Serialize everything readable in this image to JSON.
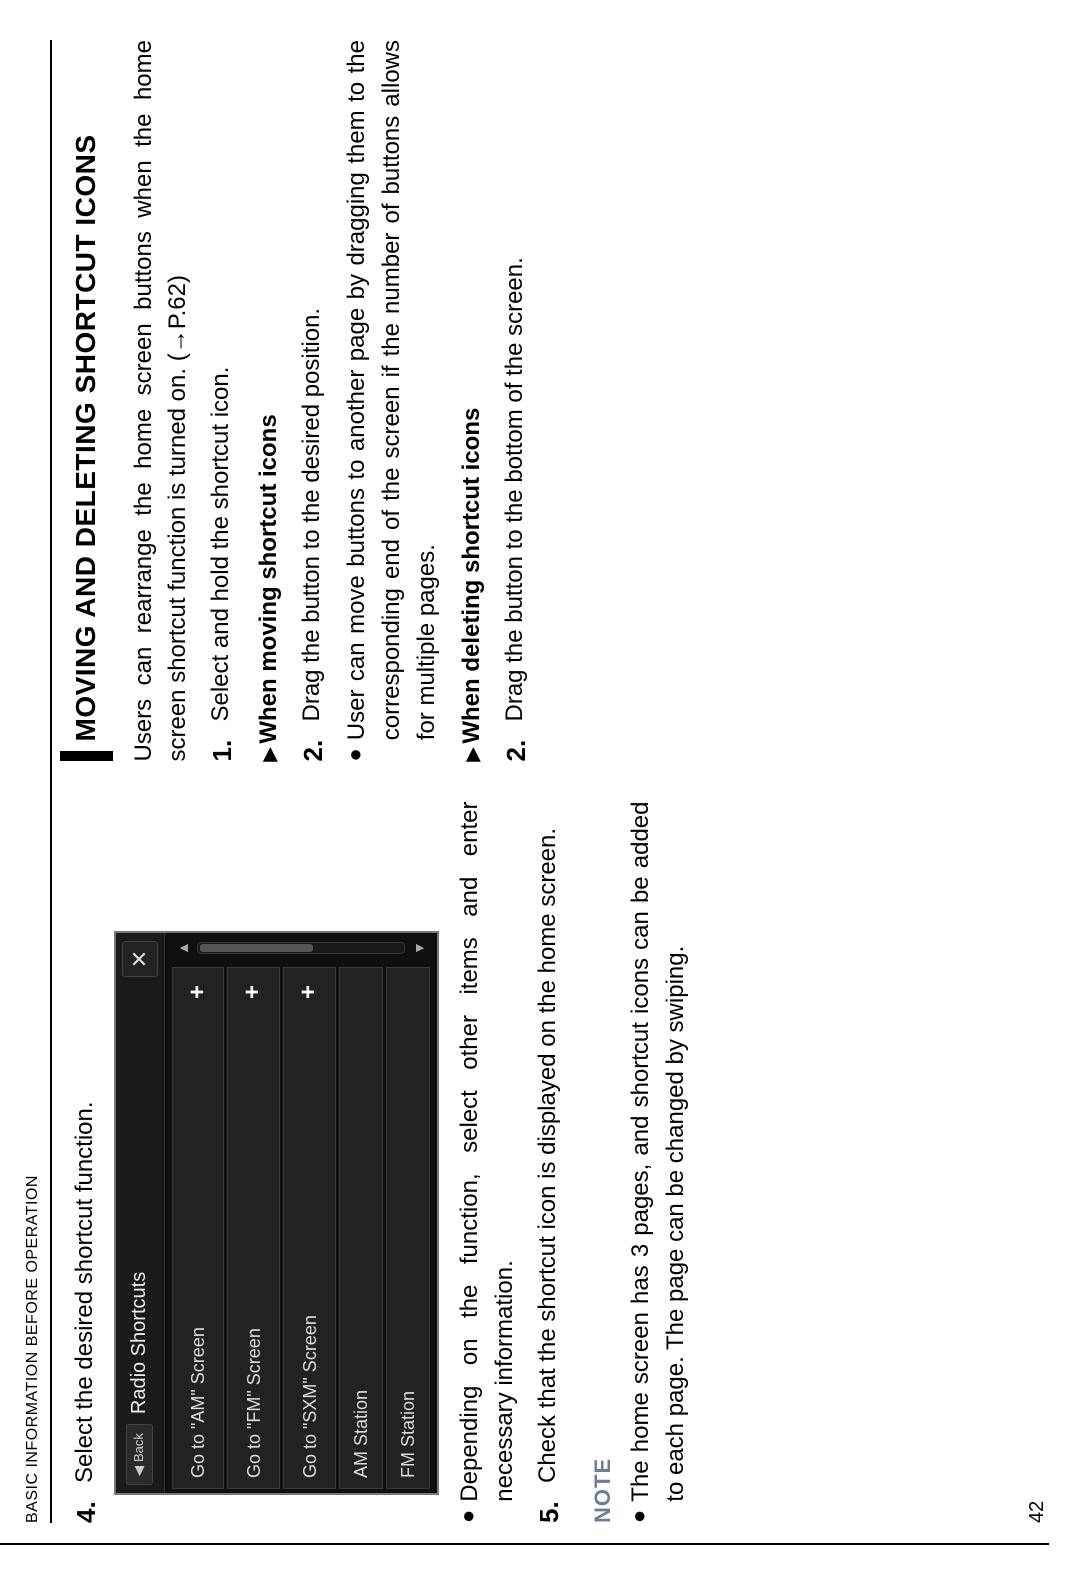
{
  "running_header": "BASIC INFORMATION BEFORE OPERATION",
  "page_number": "42",
  "left": {
    "step4_num": "4.",
    "step4_text": "Select the desired shortcut function.",
    "bullet1": "Depending on the function, select other items and enter necessary information.",
    "step5_num": "5.",
    "step5_text": "Check that the shortcut icon is displayed on the home screen.",
    "note_label": "NOTE",
    "note_bullet": "The home screen has 3 pages, and shortcut icons can be added to each page. The page can be changed by swiping."
  },
  "right": {
    "heading": "MOVING AND DELETING SHORTCUT ICONS",
    "intro": "Users can rearrange the home screen buttons when the home screen shortcut function is turned on. (→P.62)",
    "step1_num": "1.",
    "step1_text": "Select and hold the shortcut icon.",
    "moving_label": "When moving shortcut icons",
    "step2a_num": "2.",
    "step2a_text": "Drag the button to the desired position.",
    "moving_bullet": "User can move buttons to another page by dragging them to the corresponding end of the screen if the number of buttons allows for multiple pages.",
    "deleting_label": "When deleting shortcut icons",
    "step2b_num": "2.",
    "step2b_text": "Drag the button to the bottom of the screen."
  },
  "device": {
    "back": "Back",
    "title": "Radio Shortcuts",
    "rows": [
      {
        "label": "Go to \"AM\" Screen",
        "plus": true
      },
      {
        "label": "Go to \"FM\" Screen",
        "plus": true
      },
      {
        "label": "Go to \"SXM\" Screen",
        "plus": true
      },
      {
        "label": "AM Station",
        "plus": false
      },
      {
        "label": "FM Station",
        "plus": false
      }
    ]
  }
}
